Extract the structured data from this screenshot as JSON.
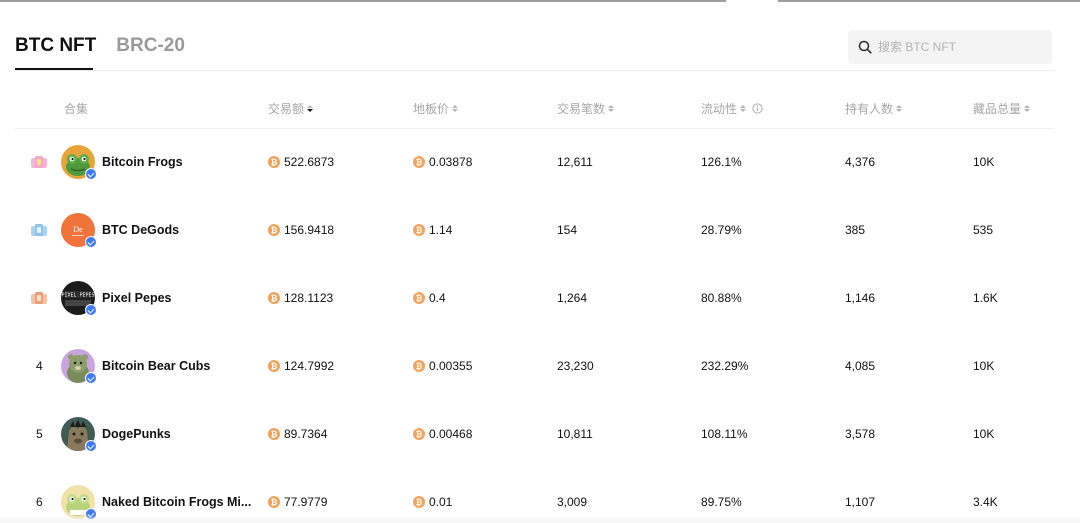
{
  "tabs": [
    {
      "label": "BTC NFT",
      "active": true
    },
    {
      "label": "BRC-20",
      "active": false
    }
  ],
  "search": {
    "placeholder": "搜索 BTC NFT"
  },
  "columns": {
    "collection": "合集",
    "volume": "交易额",
    "floor_price": "地板价",
    "trades": "交易笔数",
    "liquidity": "流动性",
    "holders": "持有人数",
    "supply": "藏品总量"
  },
  "rows": [
    {
      "rank": "1",
      "rank_icon": "gold-medal-icon",
      "name": "Bitcoin Frogs",
      "volume": "522.6873",
      "floor": "0.03878",
      "trades": "12,611",
      "liquidity": "126.1%",
      "holders": "4,376",
      "supply": "10K",
      "avatar_color": "#e8a43a"
    },
    {
      "rank": "2",
      "rank_icon": "silver-medal-icon",
      "name": "BTC DeGods",
      "volume": "156.9418",
      "floor": "1.14",
      "trades": "154",
      "liquidity": "28.79%",
      "holders": "385",
      "supply": "535",
      "avatar_color": "#f0743a",
      "avatar_text": "De"
    },
    {
      "rank": "3",
      "rank_icon": "bronze-medal-icon",
      "name": "Pixel Pepes",
      "volume": "128.1123",
      "floor": "0.4",
      "trades": "1,264",
      "liquidity": "80.88%",
      "holders": "1,146",
      "supply": "1.6K",
      "avatar_color": "#1c1c1c",
      "avatar_text": "PIXEL PEPES"
    },
    {
      "rank": "4",
      "name": "Bitcoin Bear Cubs",
      "volume": "124.7992",
      "floor": "0.00355",
      "trades": "23,230",
      "liquidity": "232.29%",
      "holders": "4,085",
      "supply": "10K",
      "avatar_color": "#c9a4e0"
    },
    {
      "rank": "5",
      "name": "DogePunks",
      "volume": "89.7364",
      "floor": "0.00468",
      "trades": "10,811",
      "liquidity": "108.11%",
      "holders": "3,578",
      "supply": "10K",
      "avatar_color": "#3e5c54"
    },
    {
      "rank": "6",
      "name": "Naked Bitcoin Frogs Mi...",
      "volume": "77.9779",
      "floor": "0.01",
      "trades": "3,009",
      "liquidity": "89.75%",
      "holders": "1,107",
      "supply": "3.4K",
      "avatar_color": "#f2e2a8"
    }
  ],
  "colors": {
    "accent": "#111111",
    "muted": "#a6a6a6",
    "btc": "#f0a35a",
    "verified": "#3d7bf2"
  }
}
